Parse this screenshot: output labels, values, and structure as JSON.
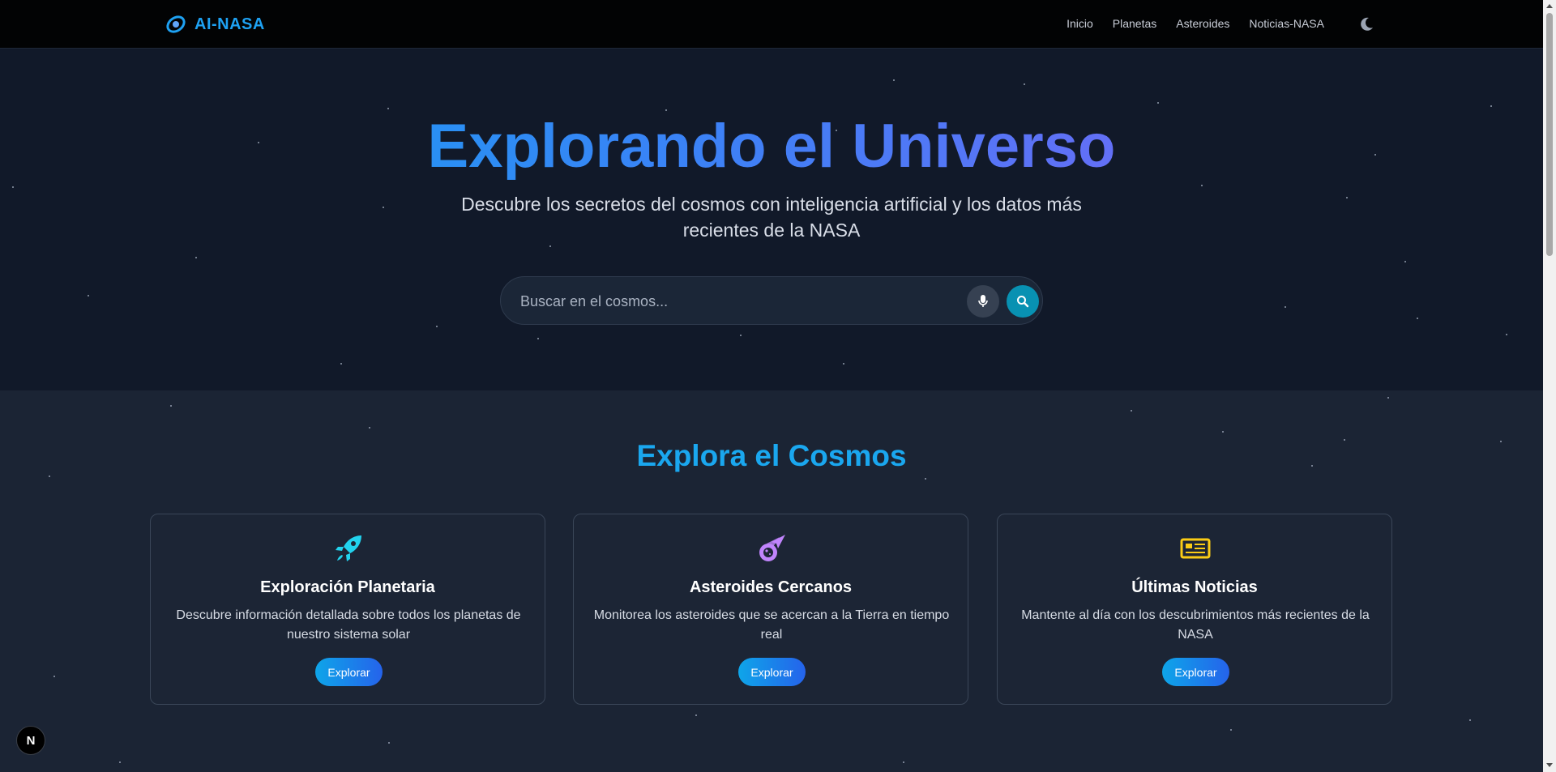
{
  "header": {
    "brand": "AI-NASA",
    "nav": [
      "Inicio",
      "Planetas",
      "Asteroides",
      "Noticias-NASA"
    ]
  },
  "hero": {
    "title": "Explorando el Universo",
    "subtitle": "Descubre los secretos del cosmos con inteligencia artificial y los datos más recientes de la NASA",
    "search_placeholder": "Buscar en el cosmos..."
  },
  "cosmos": {
    "title": "Explora el Cosmos",
    "cards": [
      {
        "icon": "rocket-icon",
        "title": "Exploración Planetaria",
        "description": "Descubre información detallada sobre todos los planetas de nuestro sistema solar",
        "button": "Explorar",
        "icon_color": "#22d3ee"
      },
      {
        "icon": "meteor-icon",
        "title": "Asteroides Cercanos",
        "description": "Monitorea los asteroides que se acercan a la Tierra en tiempo real",
        "button": "Explorar",
        "icon_color": "#c084fc"
      },
      {
        "icon": "newspaper-icon",
        "title": "Últimas Noticias",
        "description": "Mantente al día con los descubrimientos más recientes de la NASA",
        "button": "Explorar",
        "icon_color": "#facc15"
      }
    ]
  },
  "badge": "N",
  "colors": {
    "accent": "#1ea1f2",
    "button_gradient_start": "#0ea5e9",
    "button_gradient_end": "#2563eb",
    "hero_bg": "#111929",
    "section_bg": "#1b2434"
  }
}
